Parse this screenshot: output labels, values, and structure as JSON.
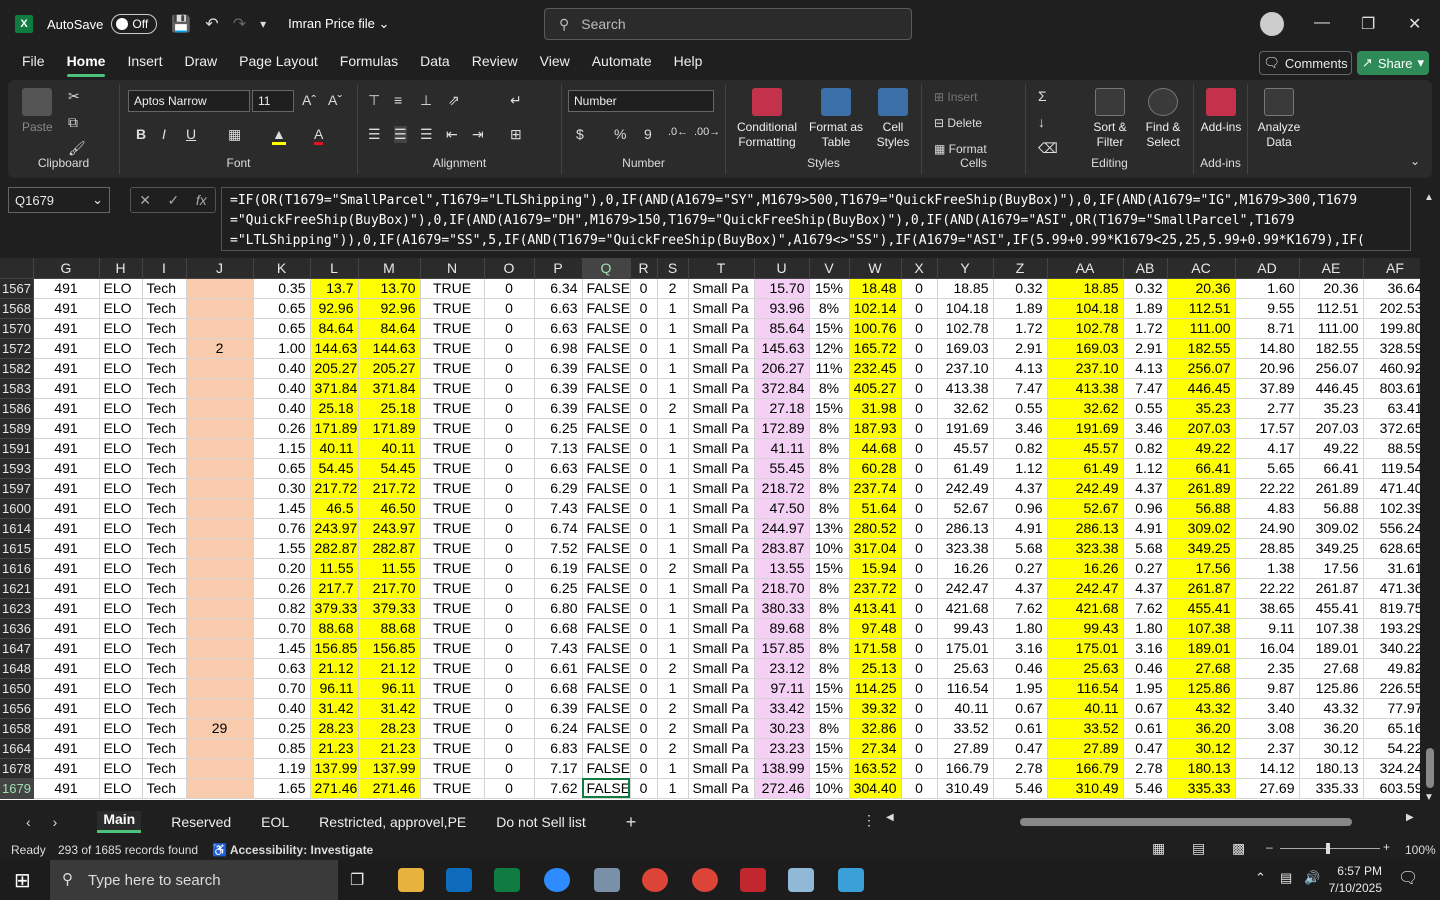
{
  "titlebar": {
    "autosave": "AutoSave",
    "toggle": "Off",
    "filename": "Imran Price file",
    "search_placeholder": "Search"
  },
  "menu": [
    "File",
    "Home",
    "Insert",
    "Draw",
    "Page Layout",
    "Formulas",
    "Data",
    "Review",
    "View",
    "Automate",
    "Help"
  ],
  "menu_active": "Home",
  "comments": "Comments",
  "share": "Share",
  "ribbon": {
    "clipboard": {
      "paste": "Paste",
      "label": "Clipboard"
    },
    "font": {
      "name": "Aptos Narrow",
      "size": "11",
      "bold": "B",
      "italic": "I",
      "underline": "U",
      "label": "Font"
    },
    "alignment": {
      "label": "Alignment"
    },
    "number": {
      "format": "Number",
      "currency": "$",
      "percent": "%",
      "comma": "9",
      "label": "Number"
    },
    "styles": {
      "cond": "Conditional\nFormatting",
      "table": "Format as\nTable",
      "cell": "Cell\nStyles",
      "label": "Styles"
    },
    "cells": {
      "insert": "Insert",
      "delete": "Delete",
      "format": "Format",
      "label": "Cells"
    },
    "editing": {
      "sort": "Sort &\nFilter",
      "find": "Find &\nSelect",
      "label": "Editing"
    },
    "addins": {
      "addins": "Add-ins",
      "label": "Add-ins"
    },
    "analyze": {
      "label": "Analyze\nData"
    }
  },
  "namebox": "Q1679",
  "formula": "=IF(OR(T1679=\"SmallParcel\",T1679=\"LTLShipping\"),0,IF(AND(A1679=\"SY\",M1679>500,T1679=\"QuickFreeShip(BuyBox)\"),0,IF(AND(A1679=\"IG\",M1679>300,T1679\n=\"QuickFreeShip(BuyBox)\"),0,IF(AND(A1679=\"DH\",M1679>150,T1679=\"QuickFreeShip(BuyBox)\"),0,IF(AND(A1679=\"ASI\",OR(T1679=\"SmallParcel\",T1679\n=\"LTLShipping\")),0,IF(A1679=\"SS\",5,IF(AND(T1679=\"QuickFreeShip(BuyBox)\",A1679<>\"SS\"),IF(A1679=\"ASI\",IF(5.99+0.99*K1679<25,25,5.99+0.99*K1679),IF(",
  "columns": [
    "G",
    "H",
    "I",
    "J",
    "K",
    "L",
    "M",
    "N",
    "O",
    "P",
    "Q",
    "R",
    "S",
    "T",
    "U",
    "V",
    "W",
    "X",
    "Y",
    "Z",
    "AA",
    "AB",
    "AC",
    "AD",
    "AE",
    "AF"
  ],
  "rows": [
    [
      "1567",
      "491",
      "ELO",
      "Tech",
      "",
      "0.35",
      "13.7",
      "13.70",
      "TRUE",
      "0",
      "6.34",
      "FALSE",
      "0",
      "2",
      "Small Pa",
      "15.70",
      "15%",
      "18.48",
      "0",
      "18.85",
      "0.32",
      "18.85",
      "0.32",
      "20.36",
      "1.60",
      "20.36",
      "36.64"
    ],
    [
      "1568",
      "491",
      "ELO",
      "Tech",
      "",
      "0.65",
      "92.96",
      "92.96",
      "TRUE",
      "0",
      "6.63",
      "FALSE",
      "0",
      "1",
      "Small Pa",
      "93.96",
      "8%",
      "102.14",
      "0",
      "104.18",
      "1.89",
      "104.18",
      "1.89",
      "112.51",
      "9.55",
      "112.51",
      "202.53"
    ],
    [
      "1570",
      "491",
      "ELO",
      "Tech",
      "",
      "0.65",
      "84.64",
      "84.64",
      "TRUE",
      "0",
      "6.63",
      "FALSE",
      "0",
      "1",
      "Small Pa",
      "85.64",
      "15%",
      "100.76",
      "0",
      "102.78",
      "1.72",
      "102.78",
      "1.72",
      "111.00",
      "8.71",
      "111.00",
      "199.80"
    ],
    [
      "1572",
      "491",
      "ELO",
      "Tech",
      "2",
      "1.00",
      "144.63",
      "144.63",
      "TRUE",
      "0",
      "6.98",
      "FALSE",
      "0",
      "1",
      "Small Pa",
      "145.63",
      "12%",
      "165.72",
      "0",
      "169.03",
      "2.91",
      "169.03",
      "2.91",
      "182.55",
      "14.80",
      "182.55",
      "328.59"
    ],
    [
      "1582",
      "491",
      "ELO",
      "Tech",
      "",
      "0.40",
      "205.27",
      "205.27",
      "TRUE",
      "0",
      "6.39",
      "FALSE",
      "0",
      "1",
      "Small Pa",
      "206.27",
      "11%",
      "232.45",
      "0",
      "237.10",
      "4.13",
      "237.10",
      "4.13",
      "256.07",
      "20.96",
      "256.07",
      "460.92"
    ],
    [
      "1583",
      "491",
      "ELO",
      "Tech",
      "",
      "0.40",
      "371.84",
      "371.84",
      "TRUE",
      "0",
      "6.39",
      "FALSE",
      "0",
      "1",
      "Small Pa",
      "372.84",
      "8%",
      "405.27",
      "0",
      "413.38",
      "7.47",
      "413.38",
      "7.47",
      "446.45",
      "37.89",
      "446.45",
      "803.61"
    ],
    [
      "1586",
      "491",
      "ELO",
      "Tech",
      "",
      "0.40",
      "25.18",
      "25.18",
      "TRUE",
      "0",
      "6.39",
      "FALSE",
      "0",
      "2",
      "Small Pa",
      "27.18",
      "15%",
      "31.98",
      "0",
      "32.62",
      "0.55",
      "32.62",
      "0.55",
      "35.23",
      "2.77",
      "35.23",
      "63.41"
    ],
    [
      "1589",
      "491",
      "ELO",
      "Tech",
      "",
      "0.26",
      "171.89",
      "171.89",
      "TRUE",
      "0",
      "6.25",
      "FALSE",
      "0",
      "1",
      "Small Pa",
      "172.89",
      "8%",
      "187.93",
      "0",
      "191.69",
      "3.46",
      "191.69",
      "3.46",
      "207.03",
      "17.57",
      "207.03",
      "372.65"
    ],
    [
      "1591",
      "491",
      "ELO",
      "Tech",
      "",
      "1.15",
      "40.11",
      "40.11",
      "TRUE",
      "0",
      "7.13",
      "FALSE",
      "0",
      "1",
      "Small Pa",
      "41.11",
      "8%",
      "44.68",
      "0",
      "45.57",
      "0.82",
      "45.57",
      "0.82",
      "49.22",
      "4.17",
      "49.22",
      "88.59"
    ],
    [
      "1593",
      "491",
      "ELO",
      "Tech",
      "",
      "0.65",
      "54.45",
      "54.45",
      "TRUE",
      "0",
      "6.63",
      "FALSE",
      "0",
      "1",
      "Small Pa",
      "55.45",
      "8%",
      "60.28",
      "0",
      "61.49",
      "1.12",
      "61.49",
      "1.12",
      "66.41",
      "5.65",
      "66.41",
      "119.54"
    ],
    [
      "1597",
      "491",
      "ELO",
      "Tech",
      "",
      "0.30",
      "217.72",
      "217.72",
      "TRUE",
      "0",
      "6.29",
      "FALSE",
      "0",
      "1",
      "Small Pa",
      "218.72",
      "8%",
      "237.74",
      "0",
      "242.49",
      "4.37",
      "242.49",
      "4.37",
      "261.89",
      "22.22",
      "261.89",
      "471.40"
    ],
    [
      "1600",
      "491",
      "ELO",
      "Tech",
      "",
      "1.45",
      "46.5",
      "46.50",
      "TRUE",
      "0",
      "7.43",
      "FALSE",
      "0",
      "1",
      "Small Pa",
      "47.50",
      "8%",
      "51.64",
      "0",
      "52.67",
      "0.96",
      "52.67",
      "0.96",
      "56.88",
      "4.83",
      "56.88",
      "102.39"
    ],
    [
      "1614",
      "491",
      "ELO",
      "Tech",
      "",
      "0.76",
      "243.97",
      "243.97",
      "TRUE",
      "0",
      "6.74",
      "FALSE",
      "0",
      "1",
      "Small Pa",
      "244.97",
      "13%",
      "280.52",
      "0",
      "286.13",
      "4.91",
      "286.13",
      "4.91",
      "309.02",
      "24.90",
      "309.02",
      "556.24"
    ],
    [
      "1615",
      "491",
      "ELO",
      "Tech",
      "",
      "1.55",
      "282.87",
      "282.87",
      "TRUE",
      "0",
      "7.52",
      "FALSE",
      "0",
      "1",
      "Small Pa",
      "283.87",
      "10%",
      "317.04",
      "0",
      "323.38",
      "5.68",
      "323.38",
      "5.68",
      "349.25",
      "28.85",
      "349.25",
      "628.65"
    ],
    [
      "1616",
      "491",
      "ELO",
      "Tech",
      "",
      "0.20",
      "11.55",
      "11.55",
      "TRUE",
      "0",
      "6.19",
      "FALSE",
      "0",
      "2",
      "Small Pa",
      "13.55",
      "15%",
      "15.94",
      "0",
      "16.26",
      "0.27",
      "16.26",
      "0.27",
      "17.56",
      "1.38",
      "17.56",
      "31.61"
    ],
    [
      "1621",
      "491",
      "ELO",
      "Tech",
      "",
      "0.26",
      "217.7",
      "217.70",
      "TRUE",
      "0",
      "6.25",
      "FALSE",
      "0",
      "1",
      "Small Pa",
      "218.70",
      "8%",
      "237.72",
      "0",
      "242.47",
      "4.37",
      "242.47",
      "4.37",
      "261.87",
      "22.22",
      "261.87",
      "471.36"
    ],
    [
      "1623",
      "491",
      "ELO",
      "Tech",
      "",
      "0.82",
      "379.33",
      "379.33",
      "TRUE",
      "0",
      "6.80",
      "FALSE",
      "0",
      "1",
      "Small Pa",
      "380.33",
      "8%",
      "413.41",
      "0",
      "421.68",
      "7.62",
      "421.68",
      "7.62",
      "455.41",
      "38.65",
      "455.41",
      "819.75"
    ],
    [
      "1636",
      "491",
      "ELO",
      "Tech",
      "",
      "0.70",
      "88.68",
      "88.68",
      "TRUE",
      "0",
      "6.68",
      "FALSE",
      "0",
      "1",
      "Small Pa",
      "89.68",
      "8%",
      "97.48",
      "0",
      "99.43",
      "1.80",
      "99.43",
      "1.80",
      "107.38",
      "9.11",
      "107.38",
      "193.29"
    ],
    [
      "1647",
      "491",
      "ELO",
      "Tech",
      "",
      "1.45",
      "156.85",
      "156.85",
      "TRUE",
      "0",
      "7.43",
      "FALSE",
      "0",
      "1",
      "Small Pa",
      "157.85",
      "8%",
      "171.58",
      "0",
      "175.01",
      "3.16",
      "175.01",
      "3.16",
      "189.01",
      "16.04",
      "189.01",
      "340.22"
    ],
    [
      "1648",
      "491",
      "ELO",
      "Tech",
      "",
      "0.63",
      "21.12",
      "21.12",
      "TRUE",
      "0",
      "6.61",
      "FALSE",
      "0",
      "2",
      "Small Pa",
      "23.12",
      "8%",
      "25.13",
      "0",
      "25.63",
      "0.46",
      "25.63",
      "0.46",
      "27.68",
      "2.35",
      "27.68",
      "49.82"
    ],
    [
      "1650",
      "491",
      "ELO",
      "Tech",
      "",
      "0.70",
      "96.11",
      "96.11",
      "TRUE",
      "0",
      "6.68",
      "FALSE",
      "0",
      "1",
      "Small Pa",
      "97.11",
      "15%",
      "114.25",
      "0",
      "116.54",
      "1.95",
      "116.54",
      "1.95",
      "125.86",
      "9.87",
      "125.86",
      "226.55"
    ],
    [
      "1656",
      "491",
      "ELO",
      "Tech",
      "",
      "0.40",
      "31.42",
      "31.42",
      "TRUE",
      "0",
      "6.39",
      "FALSE",
      "0",
      "2",
      "Small Pa",
      "33.42",
      "15%",
      "39.32",
      "0",
      "40.11",
      "0.67",
      "40.11",
      "0.67",
      "43.32",
      "3.40",
      "43.32",
      "77.97"
    ],
    [
      "1658",
      "491",
      "ELO",
      "Tech",
      "29",
      "0.25",
      "28.23",
      "28.23",
      "TRUE",
      "0",
      "6.24",
      "FALSE",
      "0",
      "2",
      "Small Pa",
      "30.23",
      "8%",
      "32.86",
      "0",
      "33.52",
      "0.61",
      "33.52",
      "0.61",
      "36.20",
      "3.08",
      "36.20",
      "65.16"
    ],
    [
      "1664",
      "491",
      "ELO",
      "Tech",
      "",
      "0.85",
      "21.23",
      "21.23",
      "TRUE",
      "0",
      "6.83",
      "FALSE",
      "0",
      "2",
      "Small Pa",
      "23.23",
      "15%",
      "27.34",
      "0",
      "27.89",
      "0.47",
      "27.89",
      "0.47",
      "30.12",
      "2.37",
      "30.12",
      "54.22"
    ],
    [
      "1678",
      "491",
      "ELO",
      "Tech",
      "",
      "1.19",
      "137.99",
      "137.99",
      "TRUE",
      "0",
      "7.17",
      "FALSE",
      "0",
      "1",
      "Small Pa",
      "138.99",
      "15%",
      "163.52",
      "0",
      "166.79",
      "2.78",
      "166.79",
      "2.78",
      "180.13",
      "14.12",
      "180.13",
      "324.24"
    ],
    [
      "1679",
      "491",
      "ELO",
      "Tech",
      "",
      "1.65",
      "271.46",
      "271.46",
      "TRUE",
      "0",
      "7.62",
      "FALSE",
      "0",
      "1",
      "Small Pa",
      "272.46",
      "10%",
      "304.40",
      "0",
      "310.49",
      "5.46",
      "310.49",
      "5.46",
      "335.33",
      "27.69",
      "335.33",
      "603.59"
    ]
  ],
  "sheets": [
    "Main",
    "Reserved",
    "EOL",
    "Restricted, approvel,PE",
    "Do not Sell list"
  ],
  "active_sheet": "Main",
  "status": {
    "ready": "Ready",
    "records": "293 of 1685 records found",
    "accessibility": "Accessibility: Investigate",
    "zoom": "100%"
  },
  "taskbar": {
    "search": "Type here to search",
    "time": "6:57 PM",
    "date": "7/10/2025"
  },
  "colors": {
    "accent": "#107c41",
    "yellow": "#ffff00",
    "peach": "#f8cbad",
    "pink": "#f4d1f4",
    "share": "#2e8b57"
  }
}
